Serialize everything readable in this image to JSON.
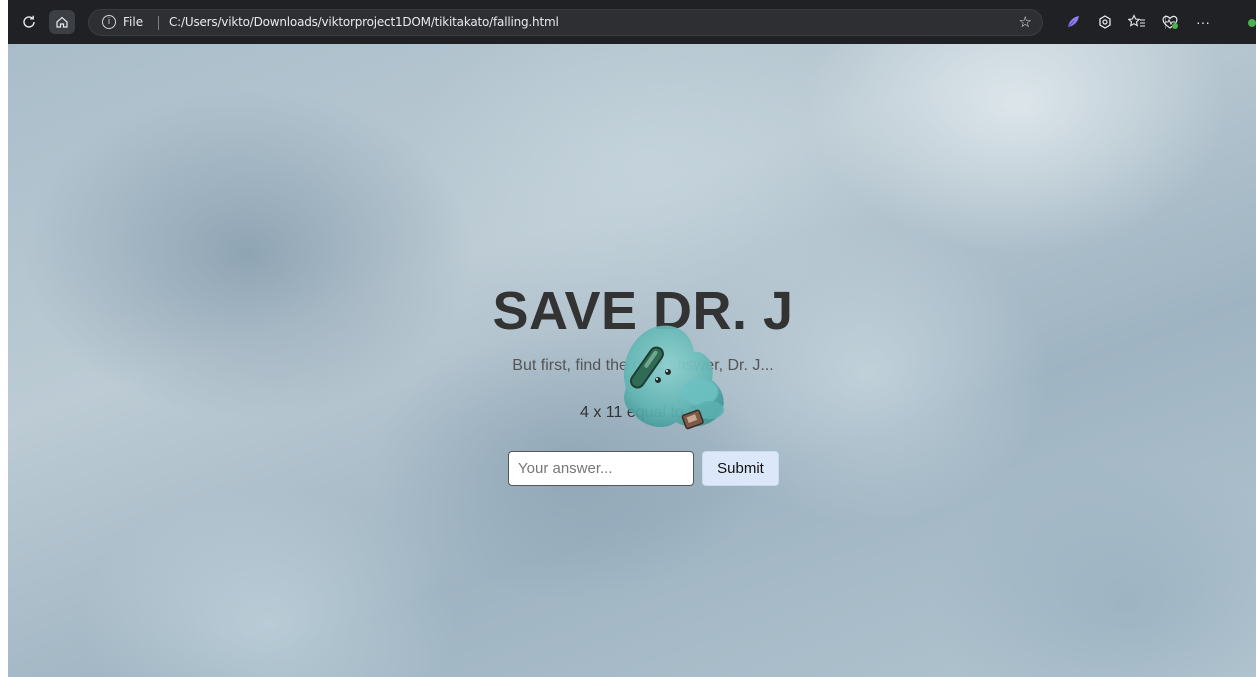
{
  "browser": {
    "reload_icon": "reload-icon",
    "home_icon": "home-icon",
    "address_info_icon": "info-icon",
    "address_scheme": "File",
    "url": "C:/Users/vikto/Downloads/viktorproject1DOM/tikitakato/falling.html",
    "favorite_icon": "star-icon",
    "extension_icons": [
      "feather-extension-icon",
      "copilot-icon",
      "favorites-icon",
      "heart-pulse-icon",
      "more-icon"
    ],
    "more_label": "···"
  },
  "page": {
    "title": "SAVE DR. J",
    "subtitle": "But first, find the right answer, Dr. J...",
    "question": "4 x 11 equal to ??",
    "answer_placeholder": "Your answer...",
    "answer_value": "",
    "submit_label": "Submit",
    "character_icon": "blue-creature-icon"
  },
  "colors": {
    "title": "#333333",
    "subtitle": "#555555",
    "submit_bg": "#dce8fa",
    "toolbar_bg": "#202124"
  }
}
